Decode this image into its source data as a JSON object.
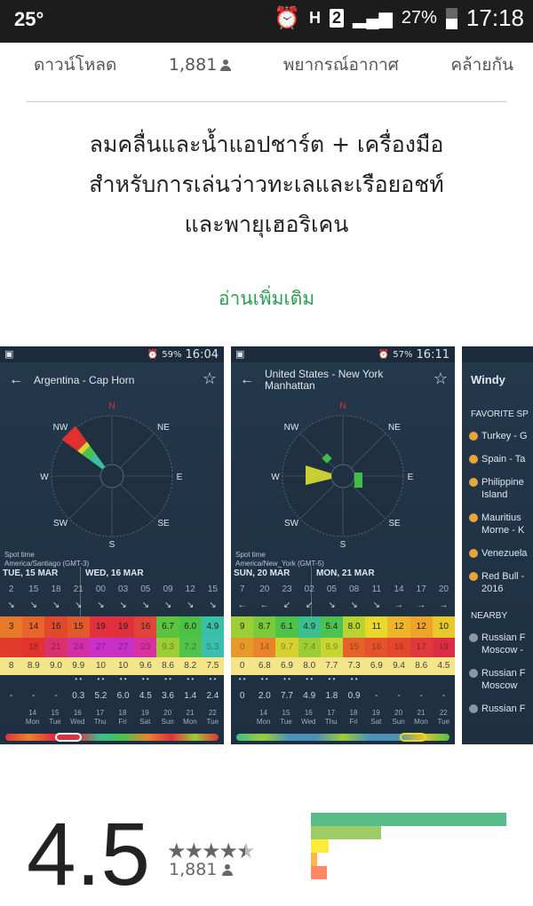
{
  "status_bar": {
    "temperature": "25°",
    "network": "H",
    "sim": "2",
    "battery": "27%",
    "time": "17:18",
    "battery_level_percent": 27
  },
  "metrics": {
    "downloads_label": "ดาวน์โหลด",
    "ratings_count": "1,881",
    "category": "พยากรณ์อากาศ",
    "similar": "คล้ายกัน"
  },
  "description": {
    "line1": "ลมคลื่นและน้ำแอปชาร์ต + เครื่องมือ",
    "line2": "สำหรับการเล่นว่าวทะเลและเรือยอชท์",
    "line3": "และพายุเฮอริเคน"
  },
  "read_more": "อ่านเพิ่มเติม",
  "screenshots": [
    {
      "battery": "59%",
      "time": "16:04",
      "title": "Argentina - Cap Horn",
      "title2": "",
      "compass": {
        "N": "N",
        "NE": "NE",
        "E": "E",
        "SE": "SE",
        "S": "S",
        "SW": "SW",
        "W": "W",
        "NW": "NW"
      },
      "spot_time": "Spot time",
      "timezone": "America/Santiago (GMT-3)",
      "day1": "TUE, 15 MAR",
      "day2": "WED, 16 MAR",
      "hours": [
        "2",
        "15",
        "18",
        "21",
        "00",
        "03",
        "05",
        "09",
        "12",
        "15"
      ],
      "arrows": [
        "↘",
        "↘",
        "↘",
        "↘",
        "↘",
        "↘",
        "↘",
        "↘",
        "↘",
        "↘"
      ],
      "wind": [
        "3",
        "14",
        "16",
        "15",
        "19",
        "19",
        "16",
        "6.7",
        "6.0",
        "4.9"
      ],
      "gusts": [
        "",
        "18",
        "21",
        "24",
        "27",
        "27",
        "23",
        "9.3",
        "7.2",
        "5.3"
      ],
      "temp": [
        "8",
        "8.9",
        "9.0",
        "9.9",
        "10",
        "10",
        "9.6",
        "8.6",
        "8.2",
        "7.5"
      ],
      "rain": [
        "-",
        "-",
        "-",
        "0.3",
        "5.2",
        "6.0",
        "4.5",
        "3.6",
        "1.4",
        "2.4"
      ],
      "wind_colors": [
        "#e7792b",
        "#e8642a",
        "#e04a2a",
        "#e35a2a",
        "#e2303c",
        "#e0303e",
        "#e2443a",
        "#5cc33f",
        "#4bc146",
        "#39c0a8"
      ],
      "gust_colors": [
        "#e03b2c",
        "#e2332d",
        "#d9306e",
        "#d12fa8",
        "#c930c8",
        "#c630c6",
        "#d930a0",
        "#9ccd35",
        "#53c24a",
        "#3dbfb0"
      ]
    },
    {
      "battery": "57%",
      "time": "16:11",
      "title": "United States - New York",
      "title2": "Manhattan",
      "compass": {
        "N": "N",
        "NE": "NE",
        "E": "E",
        "SE": "SE",
        "S": "S",
        "SW": "SW",
        "W": "W",
        "NW": "NW"
      },
      "spot_time": "Spot time",
      "timezone": "America/New_York (GMT-5)",
      "day1": "SUN, 20 MAR",
      "day2": "MON, 21 MAR",
      "hours": [
        "7",
        "20",
        "23",
        "02",
        "05",
        "08",
        "11",
        "14",
        "17",
        "20"
      ],
      "arrows": [
        "←",
        "←",
        "↙",
        "↙",
        "↘",
        "↘",
        "↘",
        "→",
        "→",
        "→"
      ],
      "wind": [
        "9",
        "8.7",
        "6.1",
        "4.9",
        "5.4",
        "8.0",
        "11",
        "12",
        "12",
        "10"
      ],
      "gusts": [
        "0",
        "14",
        "9.7",
        "7.4",
        "8.9",
        "15",
        "16",
        "16",
        "17",
        "19"
      ],
      "temp": [
        "0",
        "6.8",
        "6.9",
        "8.0",
        "7.7",
        "7.3",
        "6.9",
        "9.4",
        "8.6",
        "4.5"
      ],
      "rain": [
        "0",
        "2.0",
        "7.7",
        "4.9",
        "1.8",
        "0.9",
        "-",
        "-",
        "-",
        "-"
      ],
      "wind_colors": [
        "#9dce36",
        "#7cc93c",
        "#4fc249",
        "#3bbf8e",
        "#4cc250",
        "#b8d430",
        "#e8d82c",
        "#efb52a",
        "#eda22a",
        "#e9c82b"
      ],
      "gust_colors": [
        "#e59a2a",
        "#e8852b",
        "#d4d131",
        "#9ccd35",
        "#c6d52f",
        "#e5602b",
        "#e4532c",
        "#e3472d",
        "#e0393a",
        "#db2e45"
      ]
    }
  ],
  "day_strip": {
    "dates": [
      "14",
      "15",
      "16",
      "17",
      "18",
      "19",
      "20",
      "21",
      "22"
    ],
    "weekdays": [
      "Mon",
      "Tue",
      "Wed",
      "Thu",
      "Fri",
      "Sat",
      "Sun",
      "Mon",
      "Tue"
    ]
  },
  "side_shot": {
    "app_name": "Windy",
    "favorites_header": "FAVORITE SP",
    "favorites": [
      "Turkey - G",
      "Spain - Ta",
      "Philippine\nIsland",
      "Mauritius\nMorne - K",
      "Venezuela",
      "Red Bull -\n2016"
    ],
    "nearby_header": "NEARBY",
    "nearby": [
      "Russian F\nMoscow -",
      "Russian F\nMoscow",
      "Russian F"
    ]
  },
  "rating": {
    "score": "4.5",
    "stars": 4.5,
    "count": "1,881",
    "distribution": [
      {
        "stars": 5,
        "fraction": 1.0,
        "color": "#57bb8a"
      },
      {
        "stars": 4,
        "fraction": 0.36,
        "color": "#9ccc65"
      },
      {
        "stars": 3,
        "fraction": 0.09,
        "color": "#ffeb3b"
      },
      {
        "stars": 2,
        "fraction": 0.03,
        "color": "#ffb74d"
      },
      {
        "stars": 1,
        "fraction": 0.08,
        "color": "#ff8a65"
      }
    ]
  }
}
